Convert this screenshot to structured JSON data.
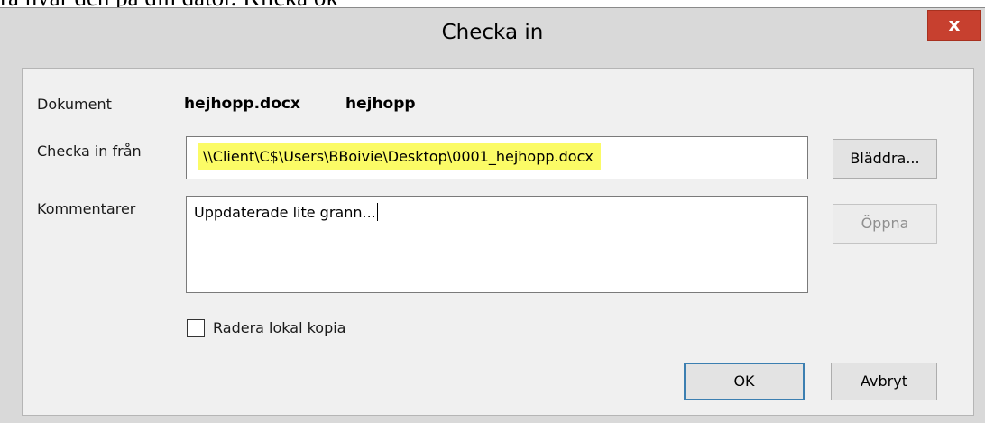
{
  "background_text": "ra hvar den på din dator. Klicka ok",
  "window": {
    "title": "Checka in",
    "close_glyph": "x"
  },
  "form": {
    "document_label": "Dokument",
    "document_filename": "hejhopp.docx",
    "document_title": "hejhopp",
    "checkin_from_label": "Checka in från",
    "checkin_from_value": "\\\\Client\\C$\\Users\\BBoivie\\Desktop\\0001_hejhopp.docx",
    "comments_label": "Kommentarer",
    "comments_value": "Uppdaterade lite grann...",
    "delete_local_label": "Radera lokal kopia",
    "delete_local_checked": false
  },
  "buttons": {
    "browse": "Bläddra...",
    "open": "Öppna",
    "ok": "OK",
    "cancel": "Avbryt"
  },
  "colors": {
    "highlight": "#fbfb66",
    "close_button": "#c7402f",
    "default_button_border": "#3c7fb1"
  }
}
